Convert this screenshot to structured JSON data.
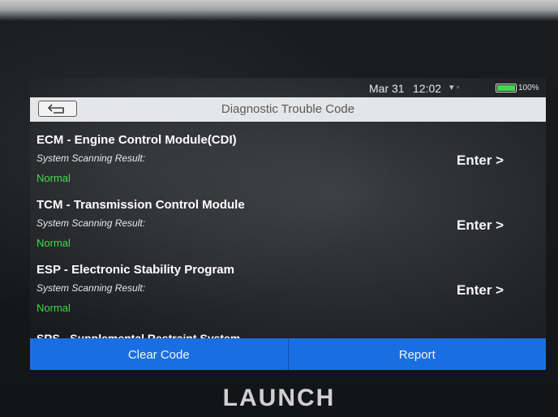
{
  "status": {
    "date": "Mar 31",
    "time": "12:02",
    "battery_percent": 100,
    "battery_label": "100%"
  },
  "header": {
    "title": "Diagnostic Trouble Code"
  },
  "modules": [
    {
      "name": "ECM - Engine Control Module(CDI)",
      "result_label": "System Scanning Result:",
      "result": "Normal",
      "action": "Enter >"
    },
    {
      "name": "TCM - Transmission Control Module",
      "result_label": "System Scanning Result:",
      "result": "Normal",
      "action": "Enter >"
    },
    {
      "name": "ESP - Electronic Stability Program",
      "result_label": "System Scanning Result:",
      "result": "Normal",
      "action": "Enter >"
    }
  ],
  "partial_module": {
    "name": "SRS - Supplemental Restraint System"
  },
  "footer": {
    "clear_label": "Clear Code",
    "report_label": "Report"
  },
  "brand": {
    "logo": "LAUNCH"
  },
  "colors": {
    "accent": "#1a6fe0",
    "status_ok": "#3ed84a"
  },
  "icons": {
    "back": "back-arrow-icon",
    "battery": "battery-icon"
  }
}
